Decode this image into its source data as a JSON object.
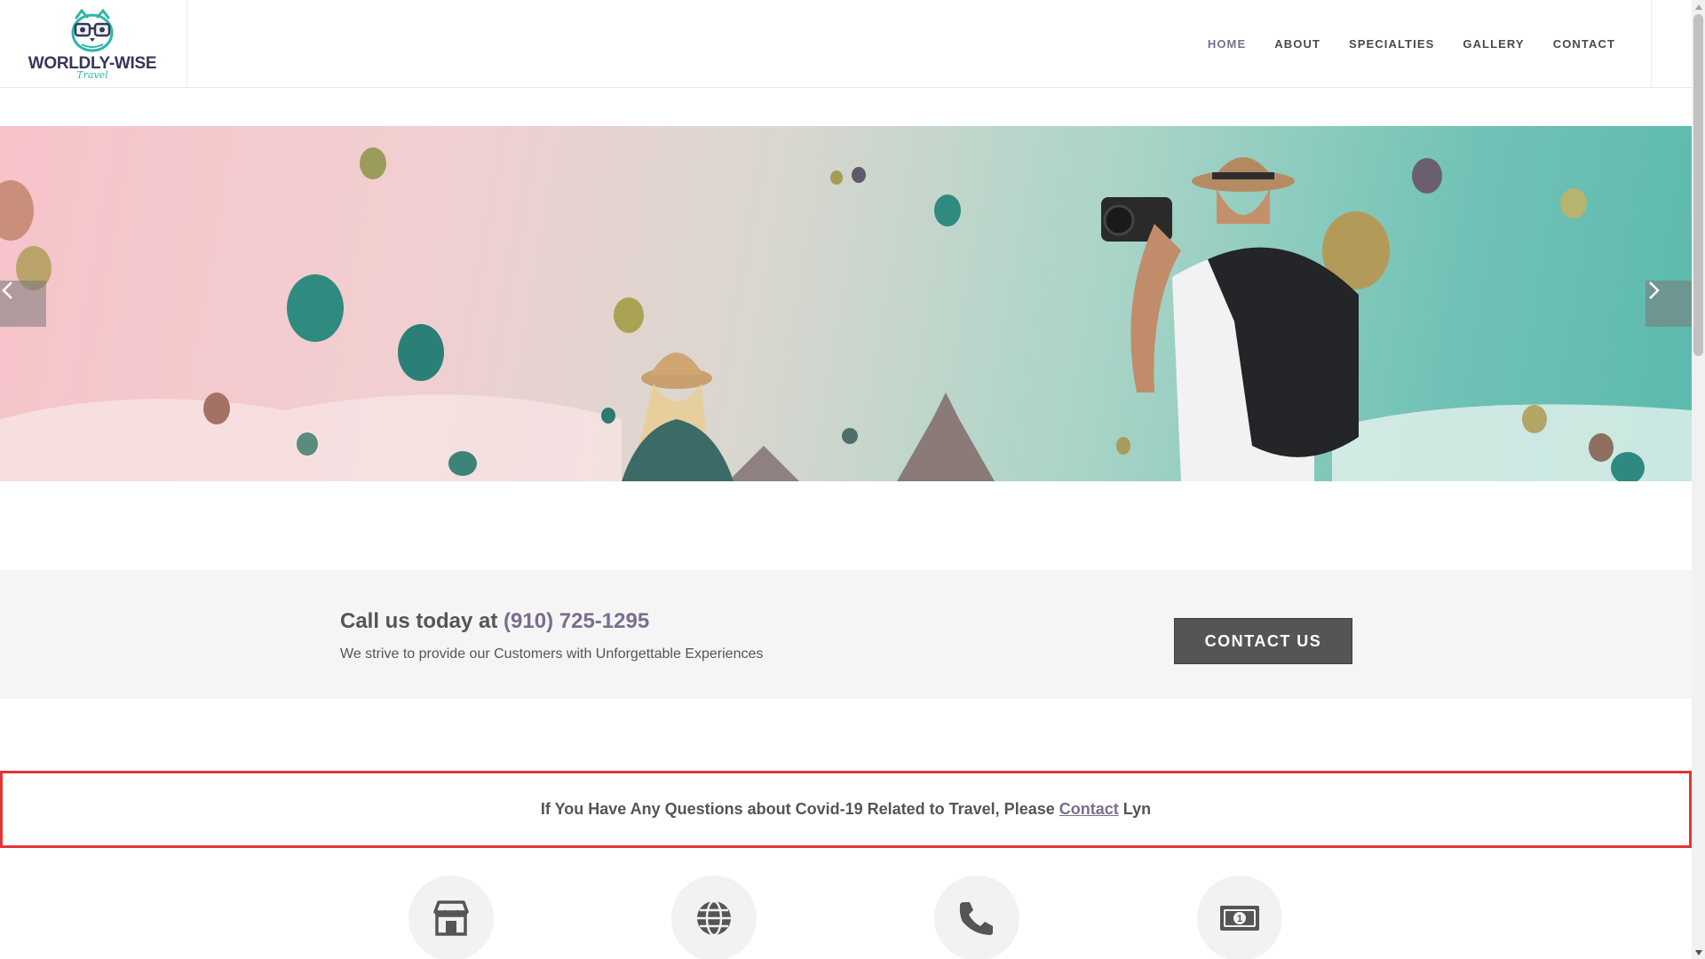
{
  "logo": {
    "name": "WORLDLY-WISE",
    "script": "Travel"
  },
  "nav": {
    "items": [
      {
        "label": "HOME",
        "active": true
      },
      {
        "label": "ABOUT"
      },
      {
        "label": "SPECIALTIES"
      },
      {
        "label": "GALLERY"
      },
      {
        "label": "CONTACT"
      }
    ]
  },
  "cta": {
    "title_prefix": "Call us today at",
    "phone": "(910) 725-1295",
    "subtitle": "We strive to provide our Customers with Unforgettable Experiences",
    "button_label": "CONTACT US"
  },
  "notice": {
    "text_before": "If You Have Any Questions about Covid-19 Related to Travel, Please",
    "link_text": "Contact",
    "text_after": "Lyn"
  },
  "features": [
    {
      "icon": "store-icon"
    },
    {
      "icon": "globe-icon"
    },
    {
      "icon": "phone-icon"
    },
    {
      "icon": "money-icon"
    }
  ],
  "colors": {
    "accent": "#7b6d8d",
    "teal": "#2fb5ac",
    "notice_border": "#e33535",
    "button_bg": "#555555"
  }
}
